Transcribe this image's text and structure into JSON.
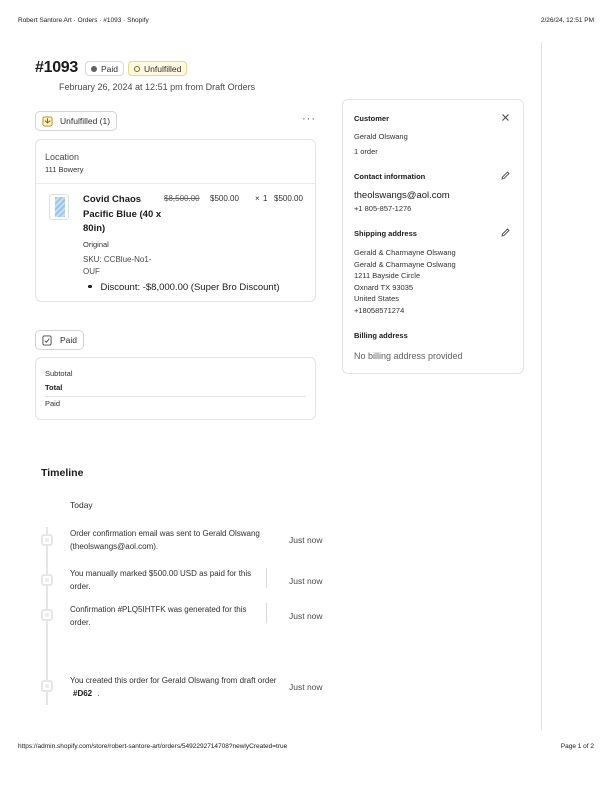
{
  "print": {
    "header_left": "Robert Santore Art · Orders · #1093 · Shopify",
    "header_right": "2/26/24, 12:51 PM",
    "footer_left": "https://admin.shopify.com/store/robert-santore-art/orders/5492292714708?newlyCreated=true",
    "footer_right": "Page 1 of 2"
  },
  "order": {
    "number": "#1093",
    "payment_badge": "Paid",
    "fulfillment_badge": "Unfulfilled",
    "date_line": "February 26, 2024 at 12:51 pm from Draft Orders"
  },
  "fulfillment": {
    "button_label": "Unfulfilled (1)",
    "more_label": "···",
    "location_label": "Location",
    "location_value": "111 Bowery",
    "item": {
      "title": "Covid Chaos Pacific Blue (40 x 80in)",
      "variant": "Original",
      "sku": "SKU: CCBlue-No1-OUF",
      "original_price": "$8,500.00",
      "price": "$500.00",
      "times": "×",
      "quantity": "1",
      "total": "$500.00",
      "discount": "Discount: -$8,000.00 (Super Bro Discount)"
    }
  },
  "payment": {
    "button_label": "Paid",
    "subtotal_label": "Subtotal",
    "total_label": "Total",
    "paid_label": "Paid"
  },
  "customer": {
    "heading": "Customer",
    "close_icon": "close-icon",
    "name": "Gerald Olswang",
    "orders": "1 order",
    "contact_heading": "Contact information",
    "email": "theolswangs@aol.com",
    "phone": "+1 805-857-1276",
    "shipping_heading": "Shipping address",
    "shipping_lines": [
      "Gerald & Charmayne Olswang",
      "Gerald & Charmayne Oslwang",
      "1211 Bayside Circle",
      "Oxnard TX 93035",
      "United States",
      "+18058571274"
    ],
    "billing_heading": "Billing address",
    "billing_value": "No billing address provided"
  },
  "timeline": {
    "title": "Timeline",
    "today": "Today",
    "events": [
      {
        "text": "Order confirmation email was sent to Gerald Olswang (theolswangs@aol.com).",
        "time": "Just now"
      },
      {
        "text": "You manually marked $500.00 USD as paid for this order.",
        "time": "Just now"
      },
      {
        "text": "Confirmation #PLQ5IHTFK was generated for this order.",
        "time": "Just now"
      },
      {
        "text_before": "You created this order for Gerald Olswang from draft order",
        "link": "#D62",
        "text_after": ".",
        "time": "Just now"
      }
    ]
  },
  "colors": {
    "unfulfilled_badge_bg": "#fff9e0",
    "unfulfilled_icon": "#8a6116",
    "border": "#e3e3e3"
  }
}
